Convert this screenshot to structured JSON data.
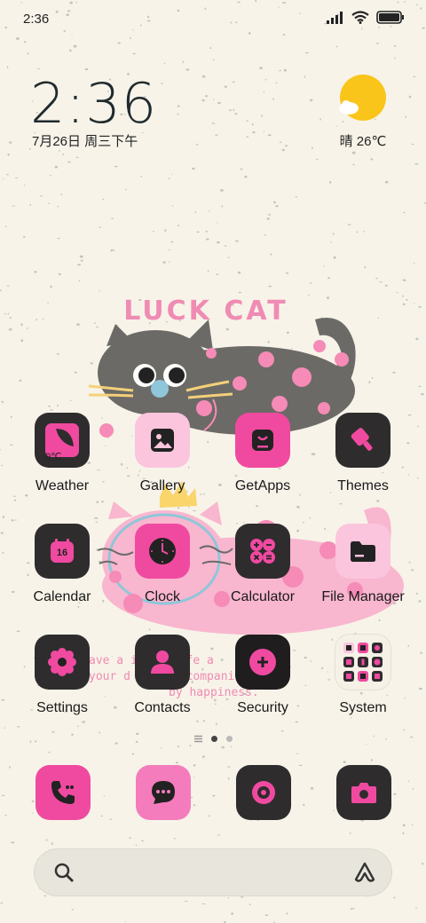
{
  "status_bar": {
    "time": "2:36"
  },
  "lockclock": {
    "time": "2:36",
    "date": "7月26日 周三下午"
  },
  "weather": {
    "temp": "晴 26℃"
  },
  "wallpaper": {
    "title": "LUCK CAT",
    "caption": [
      "ave a   innoc    life  a",
      "your d    always    companion",
      "by happiness."
    ]
  },
  "apps": {
    "row1": [
      {
        "label": "Weather",
        "icon": "weather-icon"
      },
      {
        "label": "Gallery",
        "icon": "gallery-icon"
      },
      {
        "label": "GetApps",
        "icon": "getapps-icon"
      },
      {
        "label": "Themes",
        "icon": "themes-icon"
      }
    ],
    "row2": [
      {
        "label": "Calendar",
        "icon": "calendar-icon"
      },
      {
        "label": "Clock",
        "icon": "clock-icon"
      },
      {
        "label": "Calculator",
        "icon": "calculator-icon"
      },
      {
        "label": "File Manager",
        "icon": "folder-icon"
      }
    ],
    "row3": [
      {
        "label": "Settings",
        "icon": "gear-icon"
      },
      {
        "label": "Contacts",
        "icon": "person-icon"
      },
      {
        "label": "Security",
        "icon": "shield-plus-icon"
      },
      {
        "label": "System",
        "icon": "folder-grid-icon"
      }
    ]
  },
  "weather_icon_text": "0℃",
  "calendar_icon_text": "16",
  "dock": [
    {
      "name": "phone",
      "icon": "phone-icon"
    },
    {
      "name": "messaging",
      "icon": "chat-icon"
    },
    {
      "name": "music",
      "icon": "music-icon"
    },
    {
      "name": "camera",
      "icon": "camera-icon"
    }
  ],
  "colors": {
    "background": "#f7f3e8",
    "pink": "#f04aa0",
    "light_pink": "#fbc5dd",
    "dark": "#2f2c2e",
    "sun": "#f9c51a"
  },
  "pages": {
    "count": 2,
    "active": 0
  }
}
